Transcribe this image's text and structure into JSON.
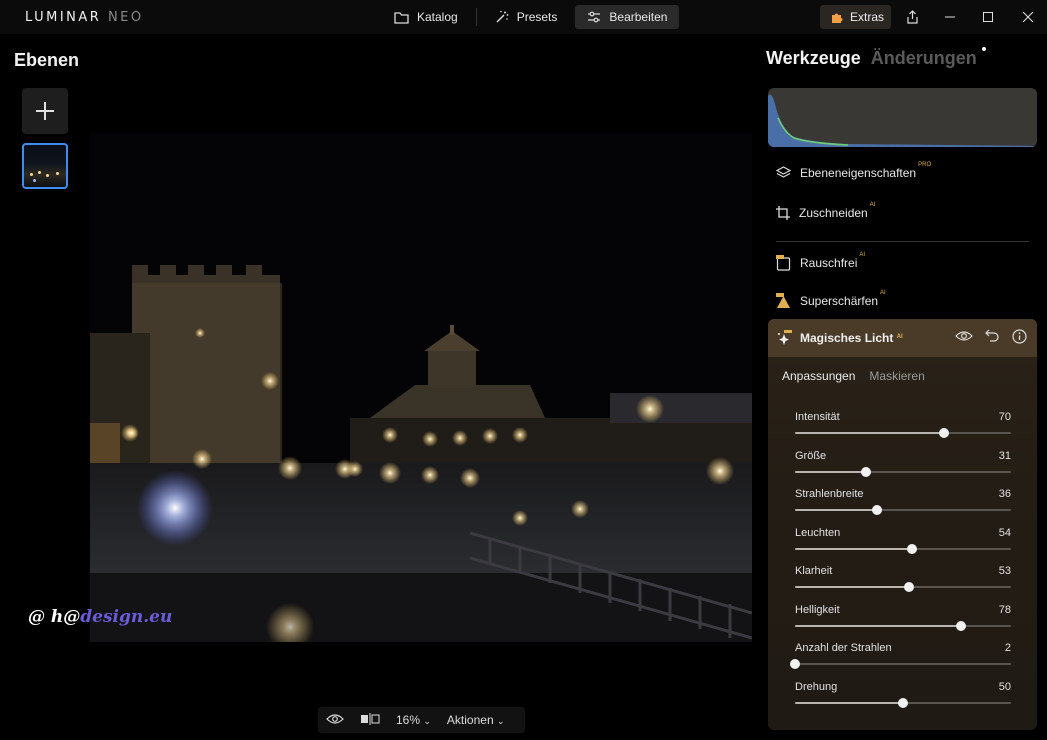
{
  "app": {
    "brand_main": "LUMINAR",
    "brand_sub": "NEO"
  },
  "topnav": [
    {
      "label": "Katalog",
      "icon": "folder-icon",
      "active": false
    },
    {
      "label": "Presets",
      "icon": "sparkle-wand-icon",
      "active": false
    },
    {
      "label": "Bearbeiten",
      "icon": "sliders-icon",
      "active": true
    }
  ],
  "extras_label": "Extras",
  "layers": {
    "title": "Ebenen"
  },
  "watermark": {
    "part1": "@ h@",
    "part2": "design.eu"
  },
  "bottombar": {
    "zoom": "16%",
    "actions": "Aktionen"
  },
  "right_panel": {
    "tab_active": "Werkzeuge",
    "tab_inactive": "Änderungen",
    "tools": [
      {
        "label": "Ebeneneigenschaften",
        "tag": "PRO",
        "icon": "layers-icon"
      },
      {
        "label": "Zuschneiden",
        "tag": "AI",
        "icon": "crop-icon"
      },
      {
        "label": "Rauschfrei",
        "tag": "AI",
        "icon": "noise-icon"
      },
      {
        "label": "Superschärfen",
        "tag": "AI",
        "icon": "sharpen-icon"
      }
    ],
    "active_tool": {
      "title": "Magisches Licht",
      "tag": "AI",
      "icon": "magic-light-icon",
      "subtabs": [
        "Anpassungen",
        "Maskieren"
      ],
      "sliders": [
        {
          "label": "Intensität",
          "value": 70,
          "fraction": 0.69
        },
        {
          "label": "Größe",
          "value": 31,
          "fraction": 0.33
        },
        {
          "label": "Strahlenbreite",
          "value": 36,
          "fraction": 0.38
        },
        {
          "label": "Leuchten",
          "value": 54,
          "fraction": 0.54
        },
        {
          "label": "Klarheit",
          "value": 53,
          "fraction": 0.53
        },
        {
          "label": "Helligkeit",
          "value": 78,
          "fraction": 0.77
        },
        {
          "label": "Anzahl der Strahlen",
          "value": 2,
          "fraction": 0.0
        },
        {
          "label": "Drehung",
          "value": 50,
          "fraction": 0.5
        }
      ]
    }
  }
}
